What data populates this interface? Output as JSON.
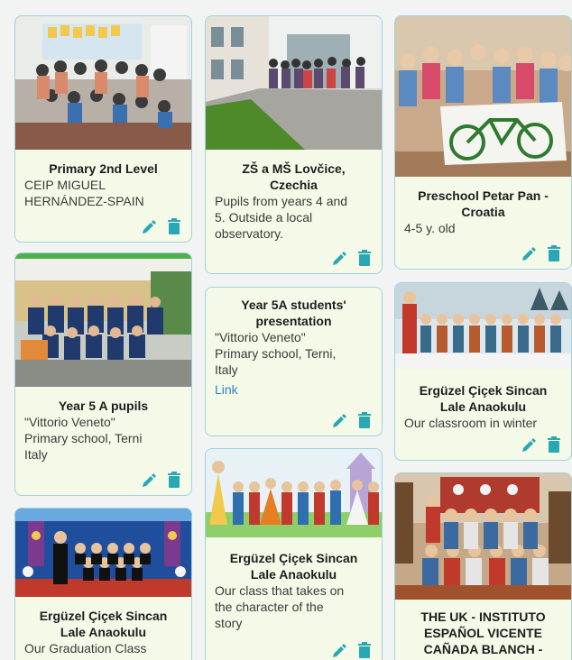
{
  "cards": [
    {
      "title": "Primary 2nd Level",
      "body": [
        "CEIP MIGUEL",
        "HERNÁNDEZ-SPAIN"
      ]
    },
    {
      "title_lines": [
        "ZŠ a MŠ Lovčice,",
        "Czechia"
      ],
      "body": [
        "Pupils from years 4 and",
        "5. Outside a local",
        "observatory."
      ]
    },
    {
      "title_lines": [
        "Preschool Petar Pan -",
        "Croatia"
      ],
      "body": [
        "4-5 y. old"
      ]
    },
    {
      "title": "Year 5 A pupils",
      "body": [
        "\"Vittorio Veneto\"",
        "Primary school, Terni",
        "Italy"
      ]
    },
    {
      "title_lines": [
        "Year 5A students'",
        "presentation"
      ],
      "body": [
        "\"Vittorio Veneto\"",
        "Primary school, Terni,",
        "Italy"
      ],
      "link": "Link"
    },
    {
      "title_lines": [
        "Ergüzel Çiçek Sincan",
        "Lale Anaokulu"
      ],
      "body": [
        "Our classroom in winter"
      ]
    },
    {
      "title_lines": [
        "Ergüzel Çiçek Sincan",
        "Lale Anaokulu"
      ],
      "body": [
        "Our Graduation Class"
      ]
    },
    {
      "title_lines": [
        "Ergüzel Çiçek Sincan",
        "Lale Anaokulu"
      ],
      "body": [
        "Our class that takes on",
        "the character of the",
        "story"
      ]
    },
    {
      "title_lines": [
        "THE UK - INSTITUTO",
        "ESPAÑOL VICENTE",
        "CAÑADA BLANCH -"
      ]
    }
  ],
  "icons": {
    "edit": "pencil-icon",
    "delete": "trash-icon"
  },
  "colors": {
    "accent": "#2aa7b4",
    "card_bg": "#f5fae8",
    "border": "#9fd3dc",
    "link": "#2d7fd0"
  }
}
